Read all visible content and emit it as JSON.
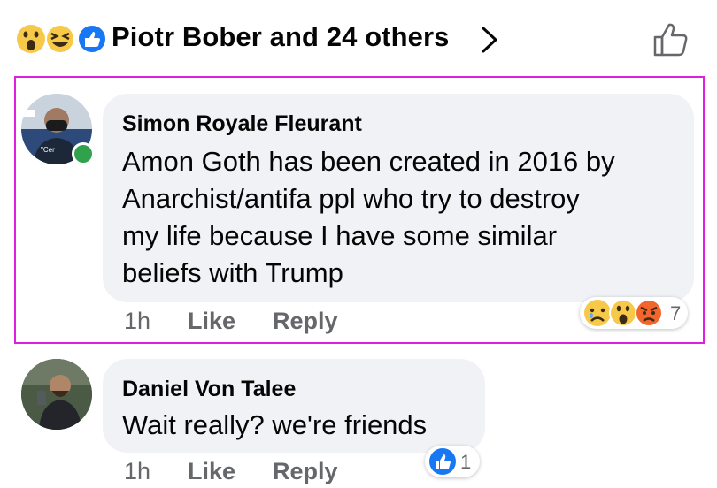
{
  "header": {
    "reaction_icons": [
      "wow-emoji-icon",
      "haha-emoji-icon",
      "like-icon"
    ],
    "title": "Piotr Bober and 24 others"
  },
  "comments": [
    {
      "author": "Simon Royale Fleurant",
      "text_lines": [
        "Amon Goth has been created in 2016 by",
        "Anarchist/antifa ppl who try to destroy",
        "my life because I have some similar",
        "beliefs with Trump"
      ],
      "time": "1h",
      "like_label": "Like",
      "reply_label": "Reply",
      "reactions": [
        "sad-emoji-icon",
        "wow-emoji-icon",
        "angry-emoji-icon"
      ],
      "reaction_count": "7",
      "avatar_caption": "\"Cer"
    },
    {
      "author": "Daniel Von Talee",
      "text_lines": [
        "Wait really? we're friends"
      ],
      "time": "1h",
      "like_label": "Like",
      "reply_label": "Reply",
      "reactions": [
        "like-icon"
      ],
      "reaction_count": "1"
    }
  ],
  "colors": {
    "like_blue": "#1877f2",
    "bubble_bg": "#f0f2f5",
    "meta_gray": "#65676b",
    "online_green": "#31a24c",
    "highlight_magenta": "#e01ee0"
  }
}
